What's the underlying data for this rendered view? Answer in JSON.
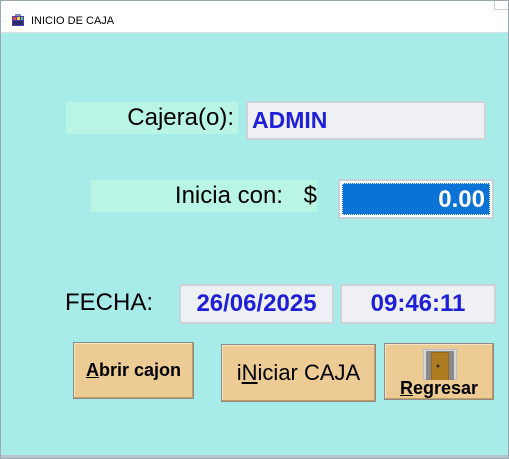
{
  "window": {
    "title": "INICIO DE CAJA",
    "icon": "cash-register-icon"
  },
  "form": {
    "cajero_label": "Cajera(o):",
    "cajero_value": "ADMIN",
    "inicia_label": "Inicia con:",
    "currency_symbol": "$",
    "inicia_value": "0.00",
    "fecha_label": "FECHA:",
    "fecha_value": "26/06/2025",
    "hora_value": "09:46:11"
  },
  "buttons": {
    "abrir_hotkey": "A",
    "abrir_rest": "brir cajon",
    "iniciar_pre": "i",
    "iniciar_hotkey": "N",
    "iniciar_rest": "iciar CAJA",
    "regresar_hotkey": "R",
    "regresar_rest": "egresar",
    "regresar_icon": "door-icon"
  },
  "colors": {
    "background": "#a8ecea",
    "label_panel": "#b8f5e4",
    "value_text": "#1f1fd8",
    "money_fill": "#0b73d6",
    "button": "#eccb94"
  }
}
